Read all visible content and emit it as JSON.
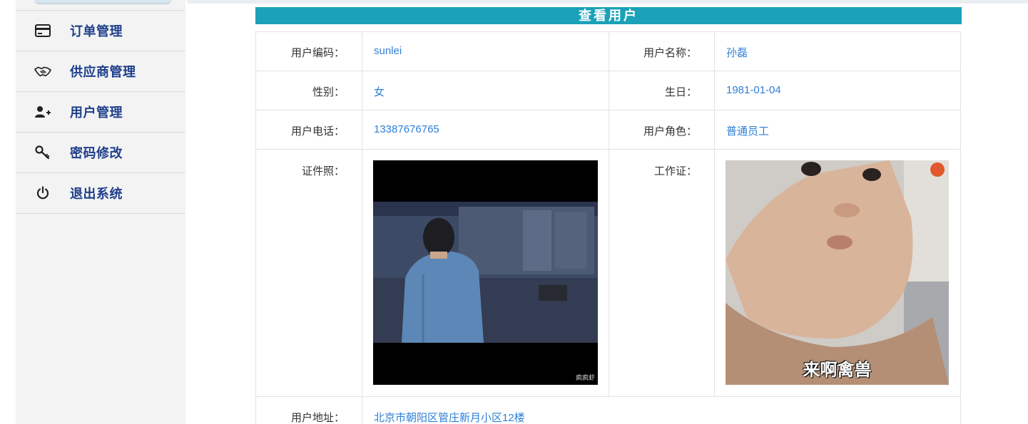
{
  "sidebar": {
    "items": [
      {
        "label": "订单管理",
        "icon": "credit-card-icon"
      },
      {
        "label": "供应商管理",
        "icon": "handshake-icon"
      },
      {
        "label": "用户管理",
        "icon": "user-add-icon"
      },
      {
        "label": "密码修改",
        "icon": "key-icon"
      },
      {
        "label": "退出系统",
        "icon": "power-icon"
      }
    ]
  },
  "header": {
    "title": "查看用户"
  },
  "user": {
    "code_label": "用户编码：",
    "code": "sunlei",
    "name_label": "用户名称：",
    "name": "孙磊",
    "gender_label": "性别：",
    "gender": "女",
    "birthday_label": "生日：",
    "birthday": "1981-01-04",
    "phone_label": "用户电话：",
    "phone": "13387676765",
    "role_label": "用户角色：",
    "role": "普通员工",
    "id_photo_label": "证件照：",
    "work_card_label": "工作证：",
    "address_label": "用户地址：",
    "address": "北京市朝阳区管庄新月小区12楼"
  },
  "images": {
    "id_photo_watermark": "疯疯虾",
    "work_card_caption": "来啊禽兽"
  },
  "colors": {
    "header_bg": "#1ba1b8",
    "menu_text": "#1e3f8a",
    "value_text": "#2f7fd6"
  }
}
